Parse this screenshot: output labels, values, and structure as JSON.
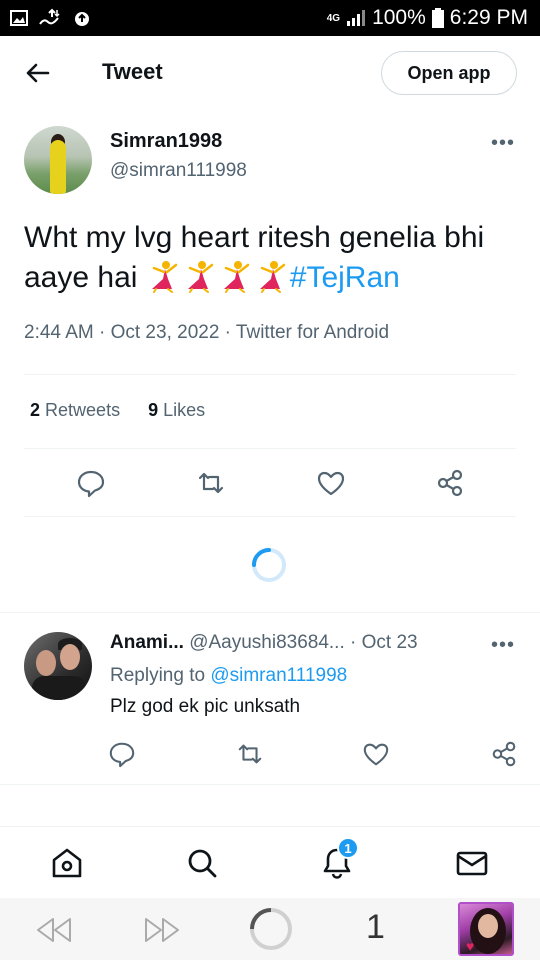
{
  "status_bar": {
    "network": "4G",
    "battery": "100%",
    "time": "6:29 PM",
    "icons": [
      "image-icon",
      "usb-transfer-icon",
      "cloud-upload-icon",
      "signal-icon",
      "battery-icon"
    ]
  },
  "header": {
    "title": "Tweet",
    "open_app_label": "Open app"
  },
  "tweet": {
    "author_name": "Simran1998",
    "author_handle": "@simran111998",
    "text": "Wht my lvg heart ritesh genelia bhi aaye hai ",
    "emoji_count": 4,
    "emoji": "dancer-emoji",
    "hashtag": "#TejRan",
    "meta": "2:44 AM · Oct 23, 2022 · Twitter for Android",
    "retweets_count": "2",
    "retweets_label": "Retweets",
    "likes_count": "9",
    "likes_label": "Likes"
  },
  "reply": {
    "author_name": "Anami...",
    "author_handle": "@Aayushi83684...",
    "date": "· Oct 23",
    "replying_prefix": "Replying to ",
    "replying_to": "@simran111998",
    "text": "Plz god ek pic unksath"
  },
  "bottom_nav": {
    "items": [
      "home-icon",
      "search-icon",
      "notifications-icon",
      "messages-icon"
    ],
    "notification_badge": "1"
  },
  "browser_bar": {
    "tab_count": "1"
  },
  "colors": {
    "accent": "#1d9bf0",
    "text_primary": "#0f1419",
    "text_secondary": "#536471"
  }
}
